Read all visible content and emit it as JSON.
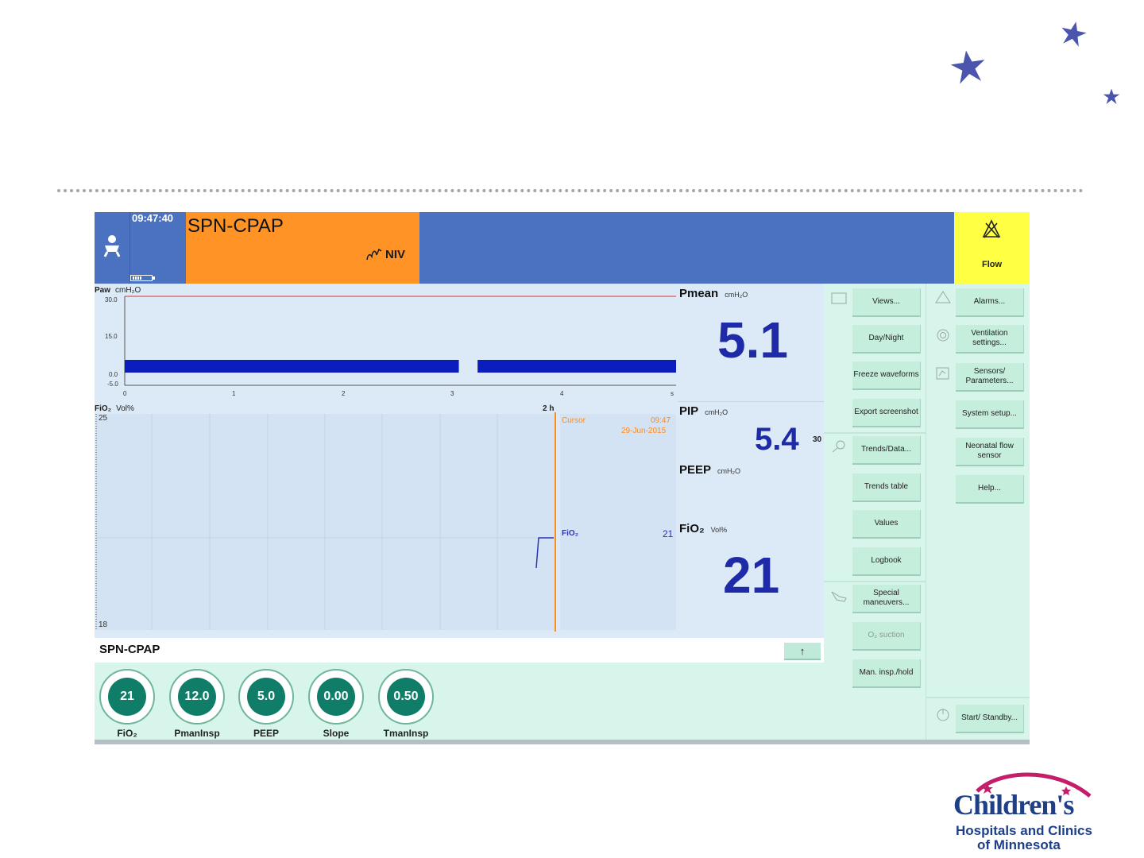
{
  "colors": {
    "header_blue": "#4a72c1",
    "mode_orange": "#ff9325",
    "alarm_yellow": "#ffff44",
    "value_blue": "#1e2aa8",
    "knob_green": "#0f7d68",
    "cursor_orange": "#ff8a1e"
  },
  "header": {
    "time": "09:47:40",
    "mode_title": "SPN-CPAP",
    "niv_label": "NIV",
    "alarm_label": "Flow"
  },
  "waveform": {
    "param": "Paw",
    "unit": "cmH₂O",
    "y_ticks": [
      "30.0",
      "15.0",
      "0.0",
      "-5.0"
    ],
    "x_ticks": [
      "0",
      "1",
      "2",
      "3",
      "4",
      "s"
    ],
    "ylim": [
      -5,
      30
    ],
    "xlim": [
      0,
      5
    ],
    "alarm_line": 30,
    "segments": [
      {
        "x_start": 0,
        "x_end": 3.03,
        "value": 5
      },
      {
        "x_start": 3.2,
        "x_end": 5,
        "value": 5
      }
    ]
  },
  "trend": {
    "param": "FiO₂",
    "unit": "Vol%",
    "span": "2 h",
    "y_max": "25",
    "y_min": "18",
    "cursor_label": "Cursor",
    "cursor_time": "09:47",
    "cursor_date": "29-Jun-2015",
    "readout_label": "FiO₂",
    "readout_value": "21"
  },
  "params": {
    "pmean": {
      "label": "Pmean",
      "unit": "cmH₂O",
      "value": "5.1"
    },
    "pip": {
      "label": "PIP",
      "unit": "cmH₂O",
      "value": "5.4",
      "limit": "30"
    },
    "peep": {
      "label": "PEEP",
      "unit": "cmH₂O"
    },
    "fio2": {
      "label": "FiO₂",
      "unit": "Vol%",
      "value": "21"
    }
  },
  "mode_bar": {
    "title": "SPN-CPAP",
    "up_symbol": "↑"
  },
  "knobs": [
    {
      "value": "21",
      "label": "FiO₂"
    },
    {
      "value": "12.0",
      "label": "PmanInsp"
    },
    {
      "value": "5.0",
      "label": "PEEP"
    },
    {
      "value": "0.00",
      "label": "Slope"
    },
    {
      "value": "0.50",
      "label": "TmanInsp"
    }
  ],
  "menu1": [
    "Views...",
    "Day/Night",
    "Freeze waveforms",
    "Export screenshot",
    "Trends/Data...",
    "Trends table",
    "Values",
    "Logbook",
    "Special maneuvers...",
    "O₂ suction",
    "Man. insp./hold"
  ],
  "menu2": [
    "Alarms...",
    "Ventilation settings...",
    "Sensors/ Parameters...",
    "System setup...",
    "Neonatal flow sensor",
    "Help...",
    "Start/ Standby..."
  ],
  "logo": {
    "name": "Children's",
    "sub1": "Hospitals and Clinics",
    "sub2": "of Minnesota"
  }
}
